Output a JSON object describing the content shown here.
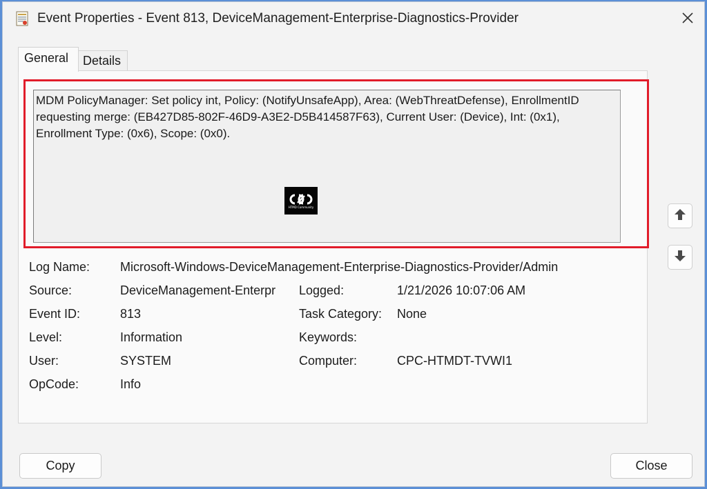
{
  "window": {
    "title": "Event Properties - Event 813, DeviceManagement-Enterprise-Diagnostics-Provider"
  },
  "tabs": [
    {
      "label": "General",
      "selected": true
    },
    {
      "label": "Details",
      "selected": false
    }
  ],
  "description": "MDM PolicyManager: Set policy int, Policy: (NotifyUnsafeApp), Area: (WebThreatDefense), EnrollmentID requesting merge: (EB427D85-802F-46D9-A3E2-D5B414587F63), Current User: (Device), Int: (0x1), Enrollment Type: (0x6), Scope: (0x0).",
  "watermark_text": "HTMD Community",
  "fields": {
    "log_name_label": "Log Name:",
    "log_name_value": "Microsoft-Windows-DeviceManagement-Enterprise-Diagnostics-Provider/Admin",
    "source_label": "Source:",
    "source_value": "DeviceManagement-Enterpr",
    "logged_label": "Logged:",
    "logged_value": "1/21/2026 10:07:06 AM",
    "event_id_label": "Event ID:",
    "event_id_value": "813",
    "task_category_label": "Task Category:",
    "task_category_value": "None",
    "level_label": "Level:",
    "level_value": "Information",
    "keywords_label": "Keywords:",
    "keywords_value": "",
    "user_label": "User:",
    "user_value": "SYSTEM",
    "computer_label": "Computer:",
    "computer_value": "CPC-HTMDT-TVWI1",
    "opcode_label": "OpCode:",
    "opcode_value": "Info"
  },
  "buttons": {
    "copy": "Copy",
    "close": "Close"
  },
  "icons": {
    "app": "event-viewer-icon",
    "close": "close-icon",
    "up": "arrow-up-icon",
    "down": "arrow-down-icon"
  },
  "colors": {
    "highlight": "#e11c2a",
    "background": "#5b8fd6"
  }
}
